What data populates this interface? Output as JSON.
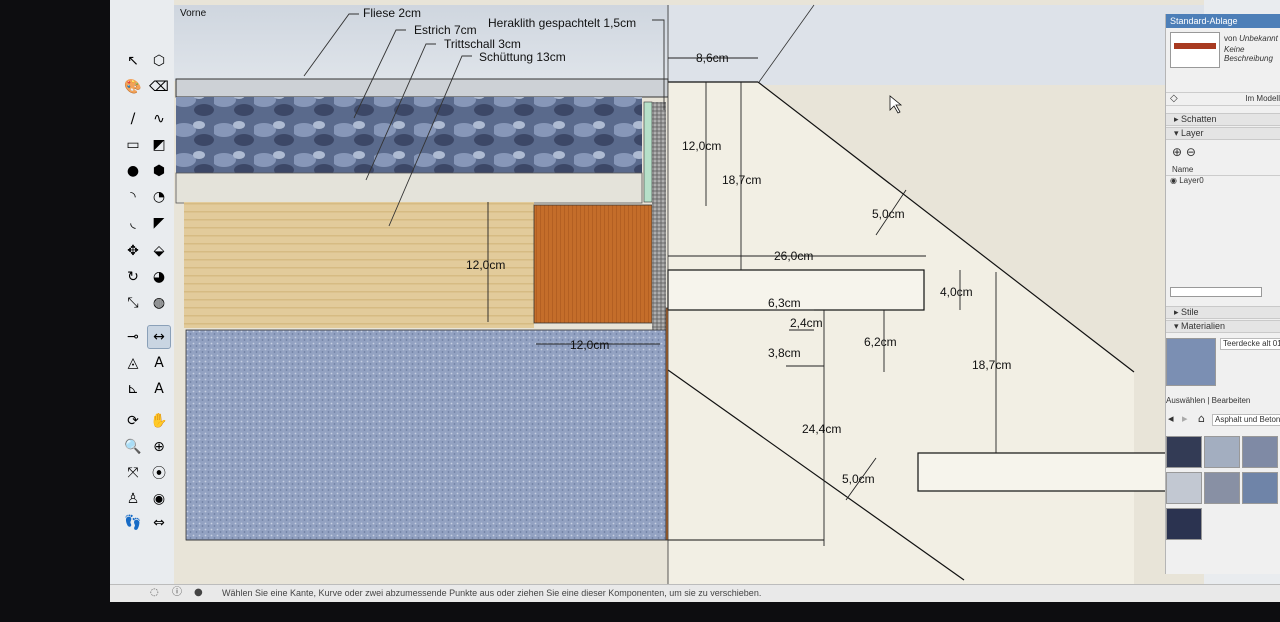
{
  "app": {
    "scene_tab": "Vorne"
  },
  "toolbar": {
    "tools": [
      {
        "name": "select-tool",
        "glyph": "↖"
      },
      {
        "name": "component-tool",
        "glyph": "⬡"
      },
      {
        "name": "paint-bucket-tool",
        "glyph": "🎨"
      },
      {
        "name": "eraser-tool",
        "glyph": "⌫"
      },
      {
        "name": "line-tool",
        "glyph": "/"
      },
      {
        "name": "freehand-tool",
        "glyph": "∿"
      },
      {
        "name": "rectangle-tool",
        "glyph": "▭"
      },
      {
        "name": "rotated-rectangle-tool",
        "glyph": "◩"
      },
      {
        "name": "circle-tool",
        "glyph": "●"
      },
      {
        "name": "polygon-tool",
        "glyph": "⬢"
      },
      {
        "name": "arc-tool",
        "glyph": "◝"
      },
      {
        "name": "pie-tool",
        "glyph": "◔"
      },
      {
        "name": "arc-2-tool",
        "glyph": "◟"
      },
      {
        "name": "arc-3-tool",
        "glyph": "◤"
      },
      {
        "name": "move-tool",
        "glyph": "✥"
      },
      {
        "name": "push-pull-tool",
        "glyph": "⬙"
      },
      {
        "name": "rotate-tool",
        "glyph": "↻"
      },
      {
        "name": "follow-me-tool",
        "glyph": "◕"
      },
      {
        "name": "scale-tool",
        "glyph": "⤡"
      },
      {
        "name": "offset-tool",
        "glyph": "◍"
      },
      {
        "name": "tape-measure-tool",
        "glyph": "⊸"
      },
      {
        "name": "dimension-tool",
        "glyph": "↔"
      },
      {
        "name": "protractor-tool",
        "glyph": "◬"
      },
      {
        "name": "text-tool",
        "glyph": "A"
      },
      {
        "name": "axes-tool",
        "glyph": "⊾"
      },
      {
        "name": "3d-text-tool",
        "glyph": "A"
      },
      {
        "name": "orbit-tool",
        "glyph": "⟳"
      },
      {
        "name": "pan-tool",
        "glyph": "✋"
      },
      {
        "name": "zoom-tool",
        "glyph": "🔍"
      },
      {
        "name": "zoom-window-tool",
        "glyph": "⊕"
      },
      {
        "name": "zoom-extents-tool",
        "glyph": "⤧"
      },
      {
        "name": "previous-view-tool",
        "glyph": "⦿"
      },
      {
        "name": "position-camera-tool",
        "glyph": "♙"
      },
      {
        "name": "look-around-tool",
        "glyph": "◉"
      },
      {
        "name": "walk-tool",
        "glyph": "👣"
      },
      {
        "name": "section-plane-tool",
        "glyph": "⇔"
      }
    ]
  },
  "layer_labels": {
    "fliese": "Fliese 2cm",
    "estrich": "Estrich 7cm",
    "trittschall": "Trittschall 3cm",
    "schuettung": "Schüttung 13cm",
    "heraklith": "Heraklith gespachtelt 1,5cm"
  },
  "dimensions": {
    "d_8_6": "8,6cm",
    "d_12_0_a": "12,0cm",
    "d_18_7_a": "18,7cm",
    "d_5_0_a": "5,0cm",
    "d_26_0": "26,0cm",
    "d_4_0": "4,0cm",
    "d_6_3": "6,3cm",
    "d_12_0_b": "12,0cm",
    "d_2_4": "2,4cm",
    "d_6_2": "6,2cm",
    "d_12_0_c": "12,0cm",
    "d_3_8": "3,8cm",
    "d_18_7_b": "18,7cm",
    "d_24_4": "24,4cm",
    "d_5_0_b": "5,0cm"
  },
  "tray": {
    "title": "Standard-Ablage",
    "entity_by": "von",
    "entity_author": "Unbekannt",
    "entity_desc": "Keine Beschreibung",
    "in_model": "Im Modell",
    "shadows": "Schatten",
    "layers": "Layer",
    "layer_col_name": "Name",
    "layer0": "Layer0",
    "styles": "Stile",
    "materials": "Materialien",
    "material_name": "Teerdecke alt 01",
    "tab_select": "Auswählen",
    "tab_edit": "Bearbeiten",
    "library": "Asphalt und Beton"
  },
  "status": {
    "hint": "Wählen Sie eine Kante, Kurve oder zwei abzumessende Punkte aus oder ziehen Sie eine dieser Komponenten, um sie zu verschieben."
  },
  "colors": {
    "accent": "#4d7fb8",
    "wood_light": "#e3cc9c",
    "wood_dark": "#c06a28",
    "gravel": "#8fa0bf",
    "estrich": "#e4e3da"
  }
}
